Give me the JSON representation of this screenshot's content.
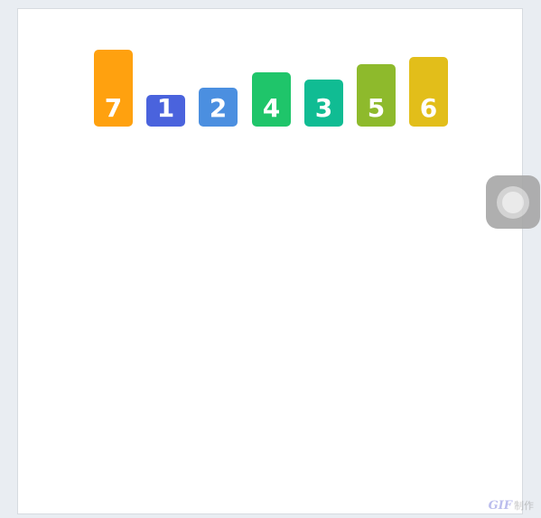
{
  "bars": [
    {
      "label": "7",
      "value": 7,
      "color": "#FFA10F"
    },
    {
      "label": "1",
      "value": 1,
      "color": "#4A63DD"
    },
    {
      "label": "2",
      "value": 2,
      "color": "#4B8FE0"
    },
    {
      "label": "4",
      "value": 4,
      "color": "#1FC56A"
    },
    {
      "label": "3",
      "value": 3,
      "color": "#10BC93"
    },
    {
      "label": "5",
      "value": 5,
      "color": "#8EBA2C"
    },
    {
      "label": "6",
      "value": 6,
      "color": "#E2BE1A"
    }
  ],
  "watermark": {
    "logo": "GIF",
    "text": "制作"
  }
}
